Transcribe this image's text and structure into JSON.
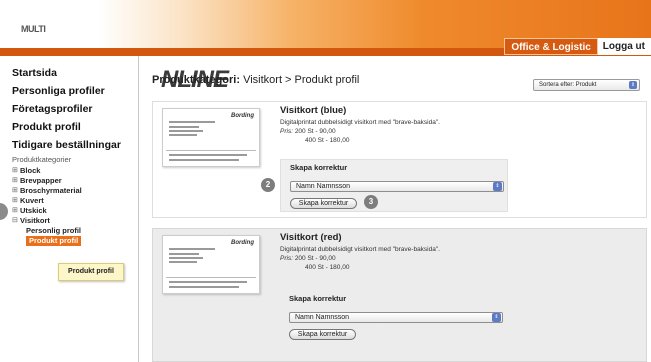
{
  "header": {
    "logo_prefix": "MULTI",
    "logo_main": "NLINE",
    "office_logistic": "Office & Logistic",
    "logout": "Logga ut"
  },
  "sidebar": {
    "nav": [
      "Startsida",
      "Personliga profiler",
      "Företagsprofiler",
      "Produkt profil",
      "Tidigare beställningar"
    ],
    "categories_title": "Produktkategorier",
    "tree": [
      "Block",
      "Brevpapper",
      "Broschyrmaterial",
      "Kuvert",
      "Utskick",
      "Visitkort"
    ],
    "tree_sub": [
      "Personlig profil",
      "Produkt profil"
    ],
    "tooltip": "Produkt profil"
  },
  "main": {
    "title_bold": "Produktkategori:",
    "title_rest": "Visitkort > Produkt profil",
    "sort_label": "Sortera efter: Produkt",
    "products": [
      {
        "name": "Visitkort (blue)",
        "description": "Digitalprintat dubbelsidigt visitkort med \"brave-baksida\".",
        "price_label": "Pris:",
        "price1": "200 St - 90,00",
        "price2": "400 St - 180,00",
        "thumb_brand": "Bording",
        "proof_title": "Skapa korrektur",
        "select_value": "Namn Namnsson",
        "button": "Skapa korrektur"
      },
      {
        "name": "Visitkort (red)",
        "description": "Digitalprintat dubbelsidigt visitkort med \"brave-baksida\".",
        "price_label": "Pris:",
        "price1": "200 St - 90,00",
        "price2": "400 St - 180,00",
        "thumb_brand": "Bording",
        "proof_title": "Skapa korrektur",
        "select_value": "Namn Namnsson",
        "button": "Skapa korrektur"
      }
    ],
    "badges": [
      "2",
      "3"
    ]
  }
}
